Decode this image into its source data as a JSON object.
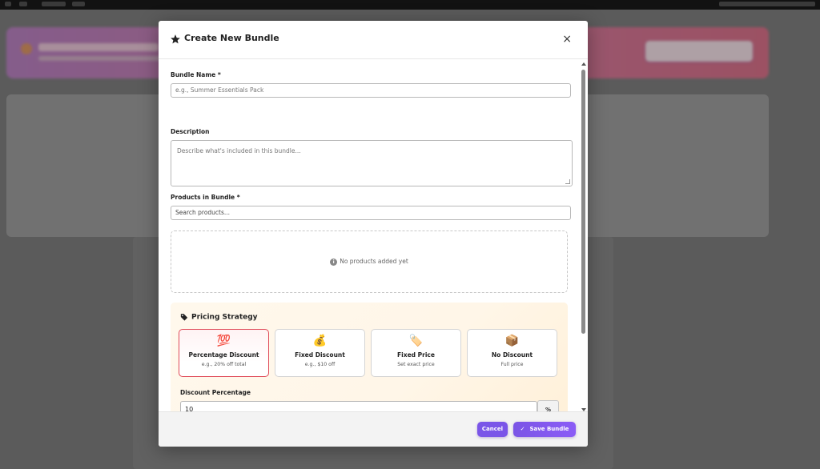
{
  "modal": {
    "title": "Create New Bundle",
    "close_label": "×"
  },
  "form": {
    "bundle_name": {
      "label": "Bundle Name *",
      "placeholder": "e.g., Summer Essentials Pack",
      "value": ""
    },
    "description": {
      "label": "Description",
      "placeholder": "Describe what's included in this bundle..."
    },
    "products": {
      "label": "Products in Bundle *",
      "search_placeholder": "Search products...",
      "empty_text": "No products added yet"
    }
  },
  "pricing": {
    "heading": "Pricing Strategy",
    "options": [
      {
        "emoji": "💯",
        "title": "Percentage Discount",
        "subtitle": "e.g., 20% off total",
        "selected": true
      },
      {
        "emoji": "💰",
        "title": "Fixed Discount",
        "subtitle": "e.g., $10 off",
        "selected": false
      },
      {
        "emoji": "🏷️",
        "title": "Fixed Price",
        "subtitle": "Set exact price",
        "selected": false
      },
      {
        "emoji": "📦",
        "title": "No Discount",
        "subtitle": "Full price",
        "selected": false
      }
    ],
    "discount_label": "Discount Percentage",
    "discount_value": "10",
    "discount_unit": "%"
  },
  "footer": {
    "cancel_label": "Cancel",
    "save_label": "Save Bundle"
  },
  "colors": {
    "accent": "#7b55e6",
    "selected_border": "#e04a58"
  }
}
